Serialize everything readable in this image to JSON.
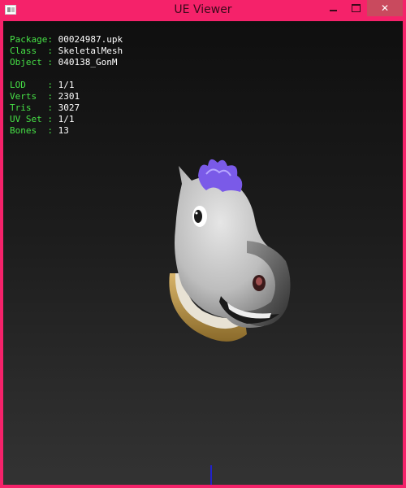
{
  "window": {
    "title": "UE Viewer",
    "controls": {
      "minimize": "minimize-icon",
      "maximize": "maximize-icon",
      "close": "close-icon"
    },
    "accent_color": "#f5226a"
  },
  "info": {
    "package_label": "Package:",
    "package_value": "00024987.upk",
    "class_label": "Class  :",
    "class_value": "SkeletalMesh",
    "object_label": "Object :",
    "object_value": "040138_GonM",
    "lod_label": "LOD    :",
    "lod_value": "1/1",
    "verts_label": "Verts  :",
    "verts_value": "2301",
    "tris_label": "Tris   :",
    "tris_value": "3027",
    "uvset_label": "UV Set :",
    "uvset_value": "1/1",
    "bones_label": "Bones  :",
    "bones_value": "13"
  },
  "colors": {
    "label": "#46e046",
    "value": "#ffffff",
    "close_button": "#c94a5e"
  }
}
